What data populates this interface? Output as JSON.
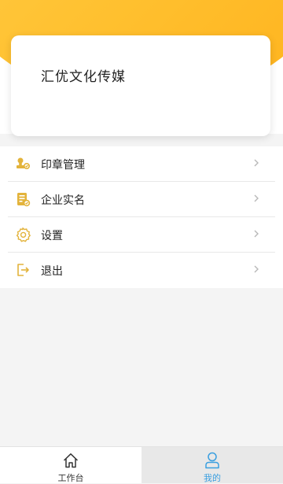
{
  "profile": {
    "company_name": "汇优文化传媒"
  },
  "menu": {
    "items": [
      {
        "label": "印章管理",
        "icon": "seal-icon"
      },
      {
        "label": "企业实名",
        "icon": "enterprise-verify-icon"
      },
      {
        "label": "设置",
        "icon": "gear-icon"
      },
      {
        "label": "退出",
        "icon": "logout-icon"
      }
    ]
  },
  "tabbar": {
    "tabs": [
      {
        "label": "工作台",
        "icon": "home-icon",
        "active": false
      },
      {
        "label": "我的",
        "icon": "user-icon",
        "active": true
      }
    ]
  },
  "colors": {
    "accent": "#ffc02f",
    "icon": "#e3b33b",
    "active_tab": "#3a9fe0"
  }
}
